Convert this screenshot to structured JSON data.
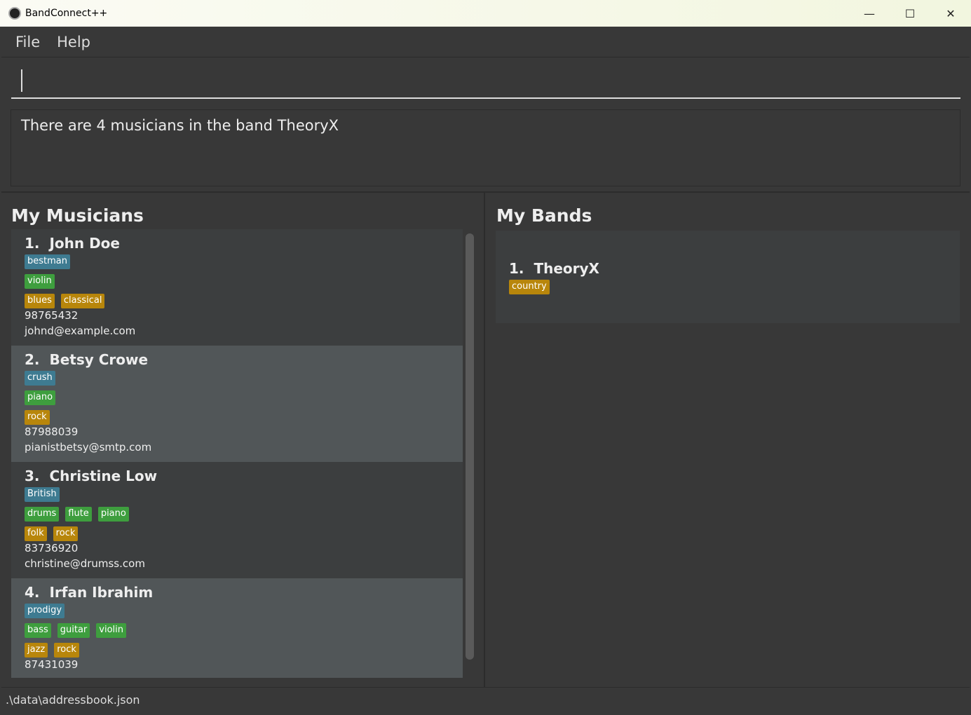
{
  "window": {
    "title": "BandConnect++",
    "minimize": "—",
    "maximize": "☐",
    "close": "✕"
  },
  "menu": [
    "File",
    "Help"
  ],
  "command": {
    "value": ""
  },
  "result": "There are 4 musicians in the band TheoryX",
  "musicians": {
    "title": "My Musicians",
    "items": [
      {
        "index": "1.",
        "name": "John Doe",
        "tags": [
          "bestman"
        ],
        "instruments": [
          "violin"
        ],
        "genres": [
          "blues",
          "classical"
        ],
        "phone": "98765432",
        "email": "johnd@example.com"
      },
      {
        "index": "2.",
        "name": "Betsy Crowe",
        "tags": [
          "crush"
        ],
        "instruments": [
          "piano"
        ],
        "genres": [
          "rock"
        ],
        "phone": "87988039",
        "email": "pianistbetsy@smtp.com"
      },
      {
        "index": "3.",
        "name": "Christine Low",
        "tags": [
          "British"
        ],
        "instruments": [
          "drums",
          "flute",
          "piano"
        ],
        "genres": [
          "folk",
          "rock"
        ],
        "phone": "83736920",
        "email": "christine@drumss.com"
      },
      {
        "index": "4.",
        "name": "Irfan Ibrahim",
        "tags": [
          "prodigy"
        ],
        "instruments": [
          "bass",
          "guitar",
          "violin"
        ],
        "genres": [
          "jazz",
          "rock"
        ],
        "phone": "87431039",
        "email": ""
      }
    ]
  },
  "bands": {
    "title": "My Bands",
    "items": [
      {
        "index": "1.",
        "name": "TheoryX",
        "genres": [
          "country"
        ]
      }
    ]
  },
  "status": ".\\data\\addressbook.json",
  "colors": {
    "tag": "#3e7b91",
    "instrument": "#3e9e3e",
    "genre": "#b8860b"
  }
}
